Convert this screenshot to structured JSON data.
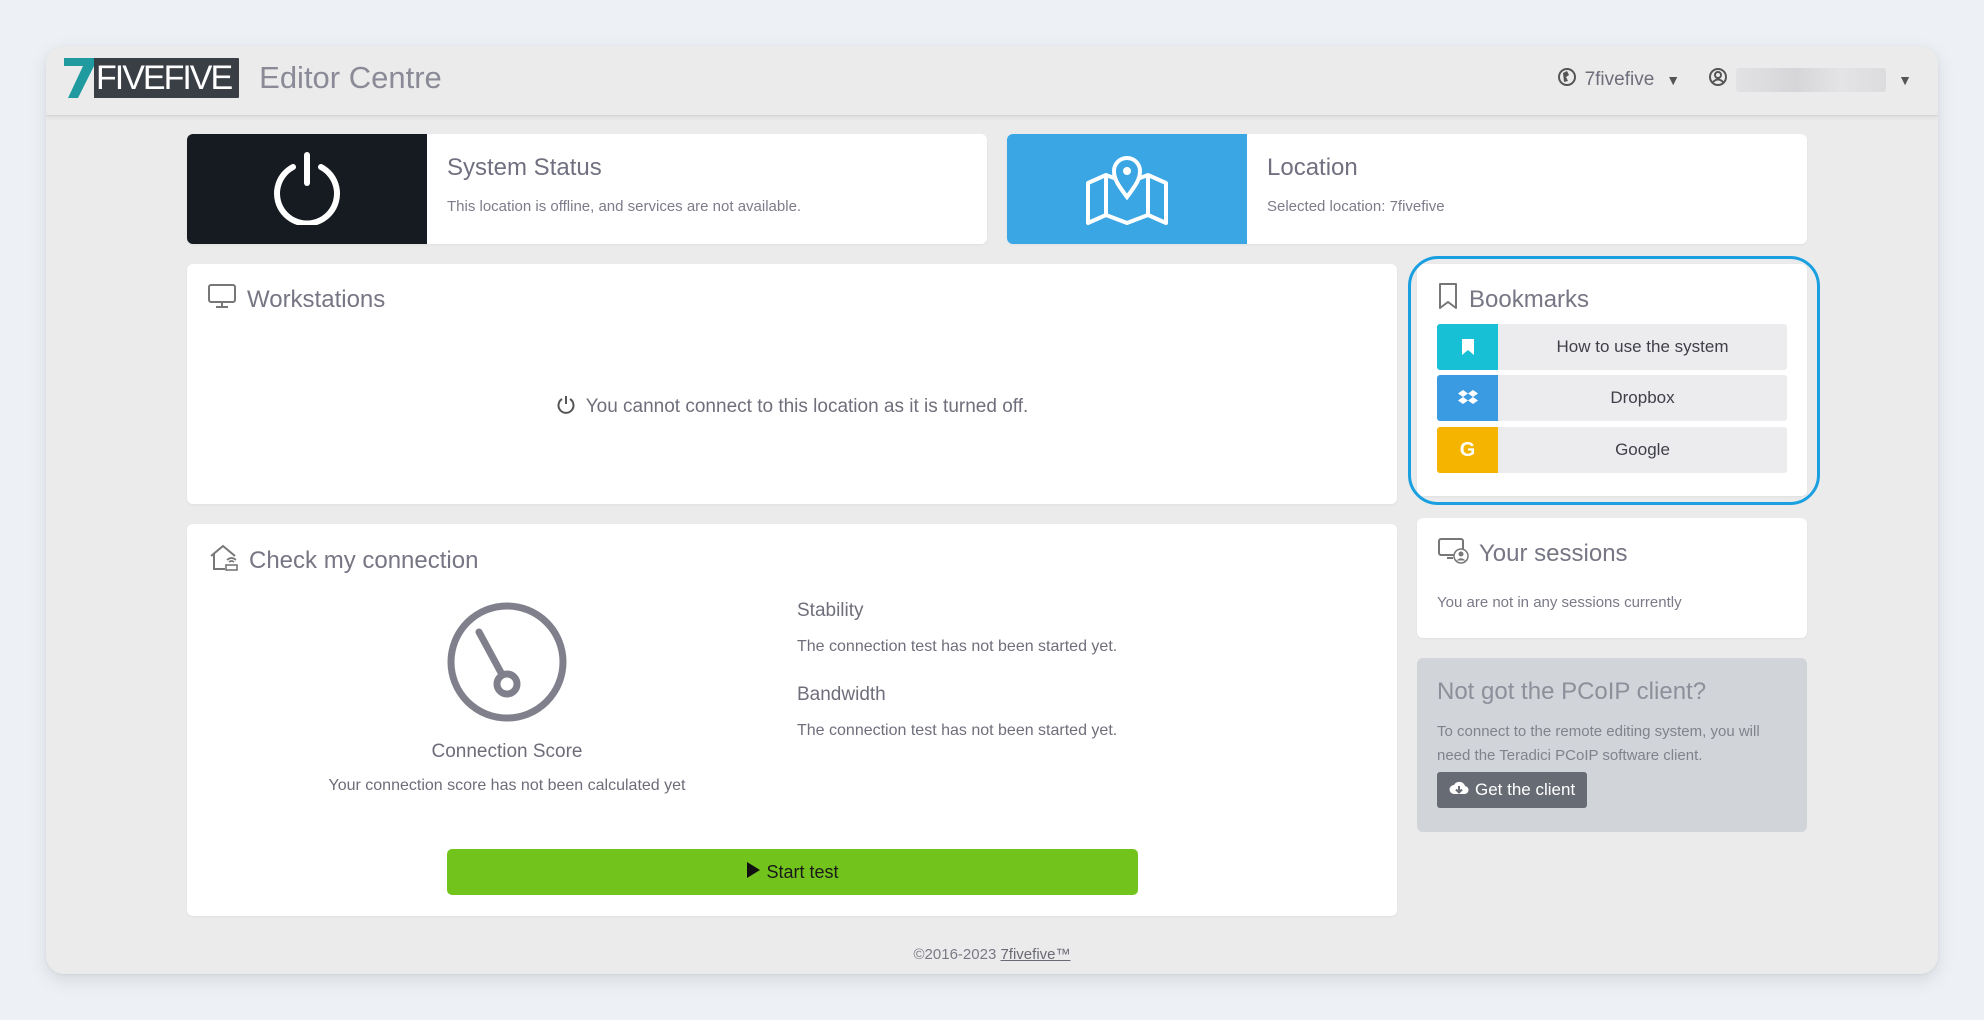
{
  "header": {
    "logo_seven": "7",
    "logo_text": "FIVEFIVE",
    "app_title": "Editor Centre",
    "org_name": "7fivefive",
    "user_name": ""
  },
  "system_status": {
    "title": "System Status",
    "text": "This location is offline, and services are not available."
  },
  "location": {
    "title": "Location",
    "text": "Selected location: 7fivefive"
  },
  "workstations": {
    "title": "Workstations",
    "message": "You cannot connect to this location as it is turned off."
  },
  "connection": {
    "title": "Check my connection",
    "score_label": "Connection Score",
    "score_text": "Your connection score has not been calculated yet",
    "stability_title": "Stability",
    "stability_text": "The connection test has not been started yet.",
    "bandwidth_title": "Bandwidth",
    "bandwidth_text": "The connection test has not been started yet.",
    "start_label": "Start test"
  },
  "bookmarks": {
    "title": "Bookmarks",
    "items": [
      {
        "label": "How to use the system",
        "icon": "bookmark-icon",
        "color": "#17c0d4"
      },
      {
        "label": "Dropbox",
        "icon": "dropbox-icon",
        "color": "#3a9be3"
      },
      {
        "label": "Google",
        "icon": "google-icon",
        "color": "#f4b400"
      }
    ]
  },
  "sessions": {
    "title": "Your sessions",
    "text": "You are not in any sessions currently"
  },
  "pcoip": {
    "title": "Not got the PCoIP client?",
    "text": "To connect to the remote editing system, you will need the Teradici PCoIP software client.",
    "button_label": "Get the client"
  },
  "footer": {
    "copyright": "©2016-2023",
    "link_text": "7fivefive™"
  },
  "colors": {
    "status_block": "#151b21",
    "location_block": "#3aa6e4",
    "start_button": "#72c41c",
    "highlight": "#1aa0e0"
  }
}
